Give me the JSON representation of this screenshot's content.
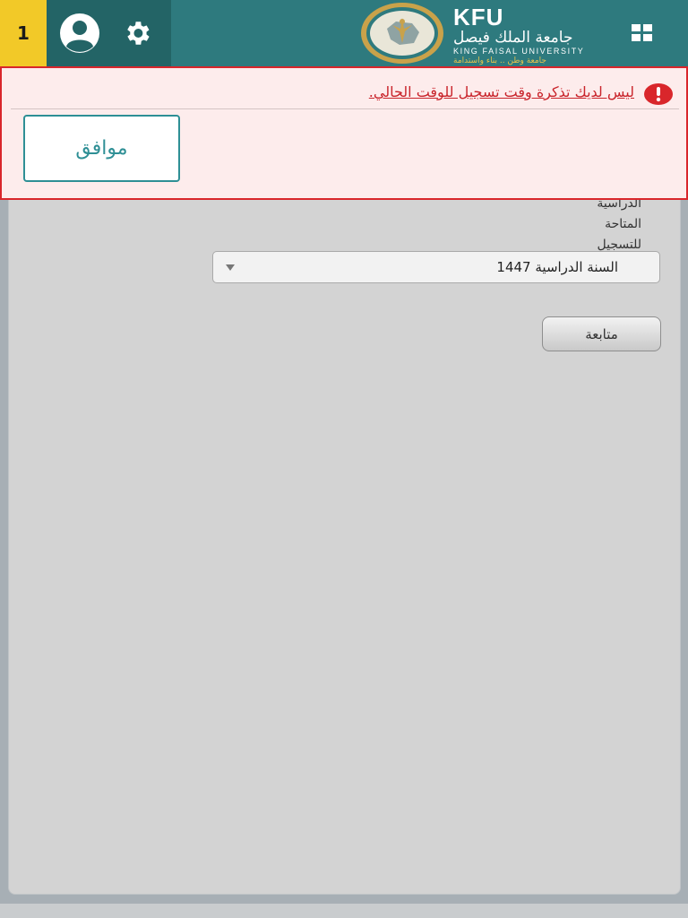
{
  "header": {
    "badge_count": "1",
    "logo": {
      "abbr": "KFU",
      "arabic_name": "جامعة الملك فيصل",
      "english_name": "KING FAISAL UNIVERSITY",
      "motto": "جامعة وطن .. بناء واستدامة"
    }
  },
  "alert": {
    "message": "ليس لديك تذكرة وقت تسجيل للوقت الحالي.",
    "ok_label": "موافق"
  },
  "form": {
    "label_lines": [
      "الدراسية",
      "المتاحة",
      "للتسجيل"
    ],
    "select": {
      "selected": "السنة الدراسية 1447"
    },
    "continue_label": "متابعة"
  },
  "colors": {
    "header_bg": "#2e7a7e",
    "badge_bg": "#f2c928",
    "alert_red": "#d9262b",
    "accent_teal": "#2e8f95"
  },
  "icons": {
    "profile": "user-icon",
    "settings": "gear-icon",
    "apps": "grid-icon",
    "alert": "exclamation-icon",
    "dropdown": "caret-down-icon"
  }
}
